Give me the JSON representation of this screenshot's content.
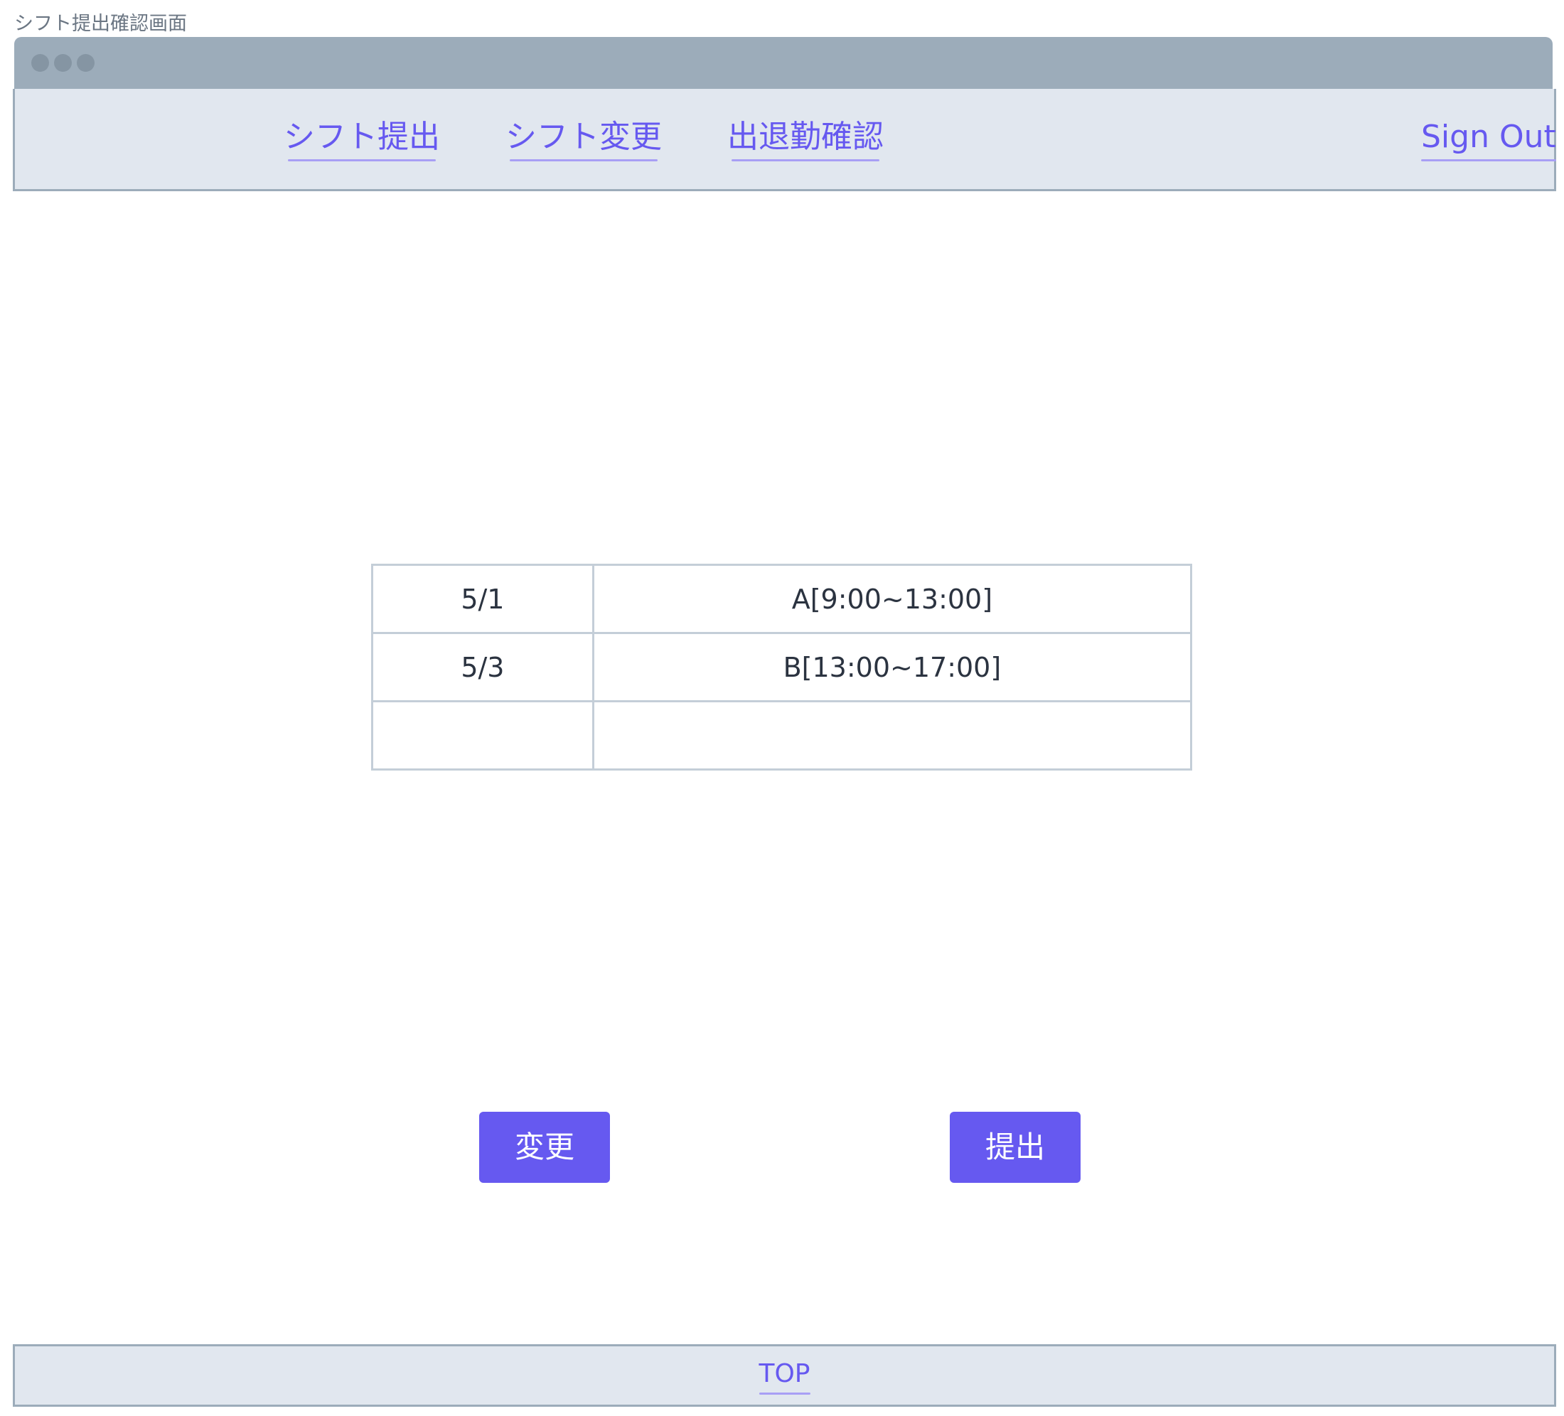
{
  "page_label": "シフト提出確認画面",
  "browser": {
    "window_controls": [
      "dot",
      "dot",
      "dot"
    ]
  },
  "nav": {
    "items": [
      {
        "label": "シフト提出"
      },
      {
        "label": "シフト変更"
      },
      {
        "label": "出退勤確認"
      }
    ],
    "sign_out": "Sign Out"
  },
  "shift_table": {
    "rows": [
      {
        "date": "5/1",
        "slot": "A[9:00~13:00]"
      },
      {
        "date": "5/3",
        "slot": "B[13:00~17:00]"
      },
      {
        "date": "",
        "slot": ""
      }
    ]
  },
  "actions": {
    "change_label": "変更",
    "submit_label": "提出"
  },
  "footer": {
    "top_link": "TOP"
  },
  "colors": {
    "accent": "#6659f0",
    "chrome": "#9cacba",
    "panel": "#e1e7ef",
    "grid": "#c4ced8"
  }
}
